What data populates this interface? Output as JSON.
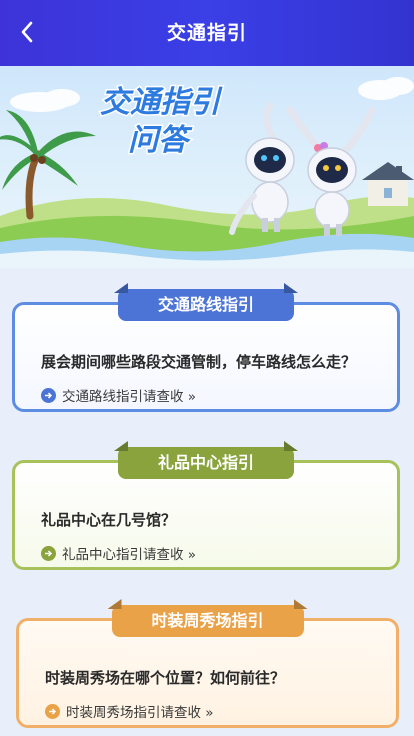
{
  "header": {
    "title": "交通指引"
  },
  "banner": {
    "title_line1": "交通指引",
    "title_line2": "问答"
  },
  "cards": [
    {
      "tab": "交通路线指引",
      "question": "展会期间哪些路段交通管制，停车路线怎么走？",
      "link": "交通路线指引请查收 »"
    },
    {
      "tab": "礼品中心指引",
      "question": "礼品中心在几号馆？",
      "link": "礼品中心指引请查收 »"
    },
    {
      "tab": "时装周秀场指引",
      "question": "时装周秀场在哪个位置？如何前往？",
      "link": "时装周秀场指引请查收 »"
    }
  ],
  "colors": {
    "header": "#3a3fe6",
    "card1": "#4b74d6",
    "card2": "#8aa33c",
    "card3": "#e9a248"
  }
}
